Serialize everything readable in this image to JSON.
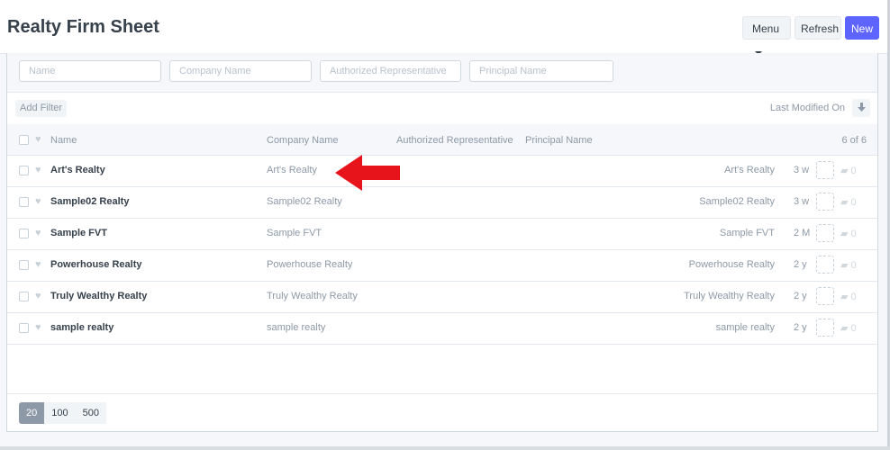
{
  "header": {
    "title": "Realty Firm Sheet",
    "menu_label": "Menu",
    "refresh_label": "Refresh",
    "new_label": "New"
  },
  "filters": {
    "name_placeholder": "Name",
    "company_placeholder": "Company Name",
    "rep_placeholder": "Authorized Representative",
    "principal_placeholder": "Principal Name"
  },
  "filter_bar": {
    "add_filter_label": "Add Filter",
    "sort_label": "Last Modified On",
    "sort_icon": "arrow-down-icon"
  },
  "list_header": {
    "name": "Name",
    "company": "Company Name",
    "rep": "Authorized Representative",
    "principal": "Principal Name",
    "count": "6 of 6"
  },
  "rows": [
    {
      "title": "Art's Realty",
      "company": "Art's Realty",
      "rep": "Art's Realty",
      "time": "3 w",
      "comments": "0"
    },
    {
      "title": "Sample02 Realty",
      "company": "Sample02 Realty",
      "rep": "Sample02 Realty",
      "time": "3 w",
      "comments": "0"
    },
    {
      "title": "Sample FVT",
      "company": "Sample FVT",
      "rep": "Sample FVT",
      "time": "2 M",
      "comments": "0"
    },
    {
      "title": "Powerhouse Realty",
      "company": "Powerhouse Realty",
      "rep": "Powerhouse Realty",
      "time": "2 y",
      "comments": "0"
    },
    {
      "title": "Truly Wealthy Realty",
      "company": "Truly Wealthy Realty",
      "rep": "Truly Wealthy Realty",
      "time": "2 y",
      "comments": "0"
    },
    {
      "title": "sample realty",
      "company": "sample realty",
      "rep": "sample realty",
      "time": "2 y",
      "comments": "0"
    }
  ],
  "paging": {
    "options": [
      "20",
      "100",
      "500"
    ],
    "selected": "20"
  },
  "colors": {
    "accent": "#5e64ff",
    "annotation_arrow": "#e8141b"
  }
}
